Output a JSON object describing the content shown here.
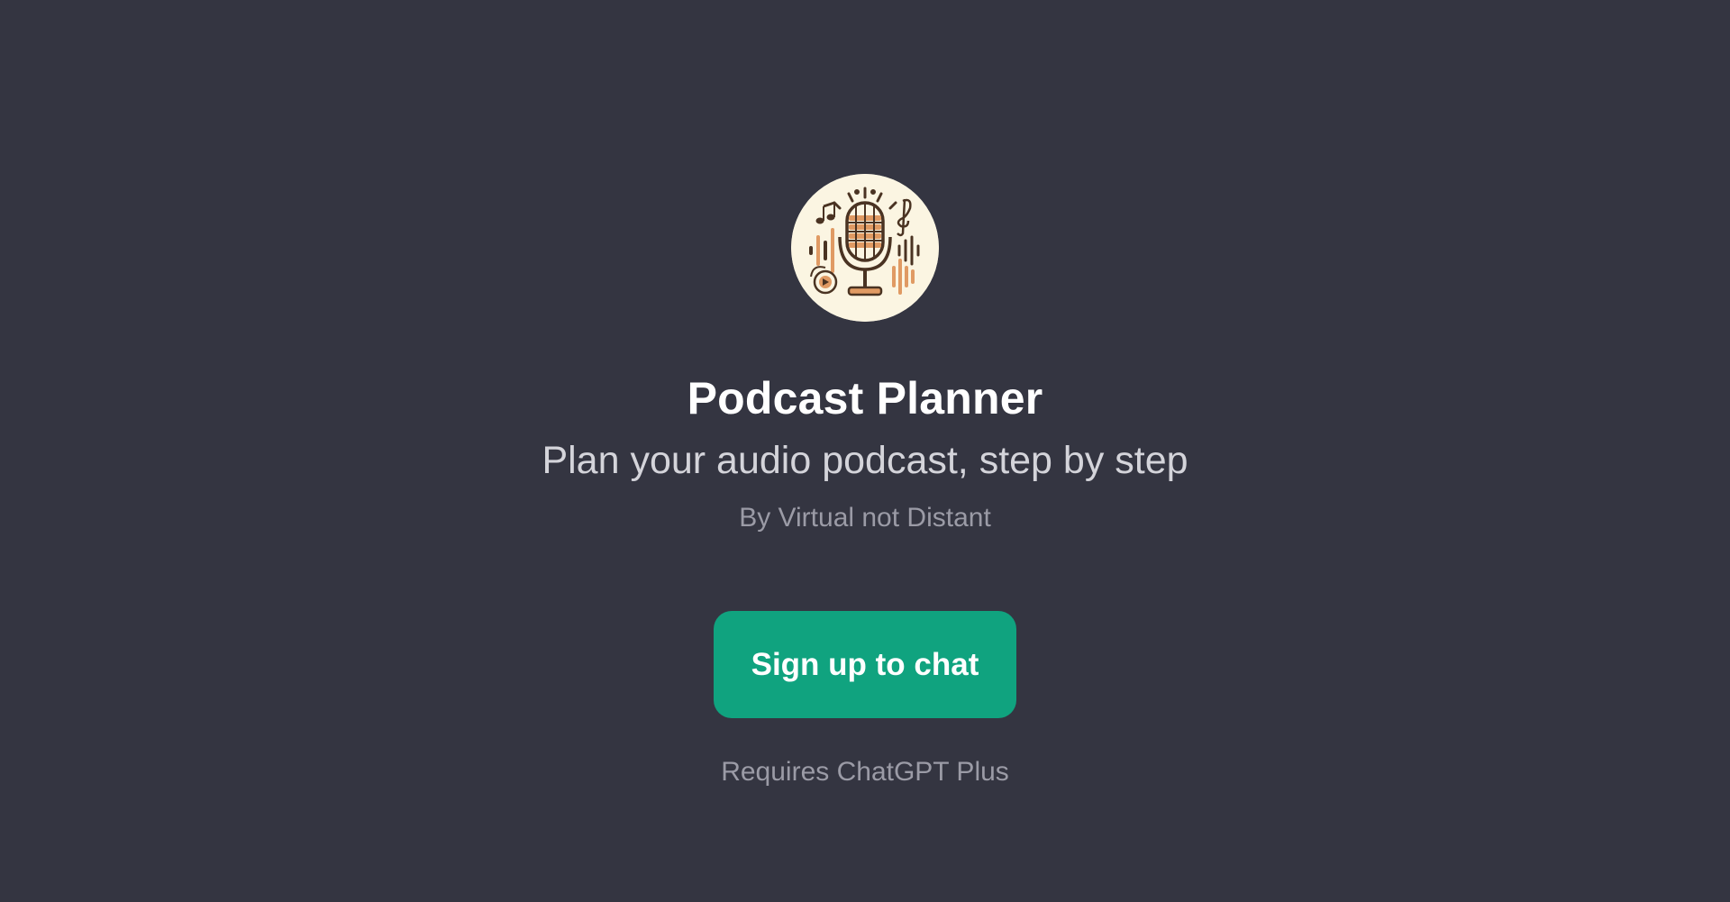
{
  "gpt": {
    "logo_icon": "podcast-microphone-icon",
    "title": "Podcast Planner",
    "description": "Plan your audio podcast, step by step",
    "author": "By Virtual not Distant"
  },
  "actions": {
    "signup_label": "Sign up to chat",
    "requirement_note": "Requires ChatGPT Plus"
  },
  "colors": {
    "background": "#343541",
    "button": "#10a37f",
    "logo_background": "#fbf5e2",
    "logo_ink": "#4a3322",
    "logo_accent": "#e09a63"
  }
}
